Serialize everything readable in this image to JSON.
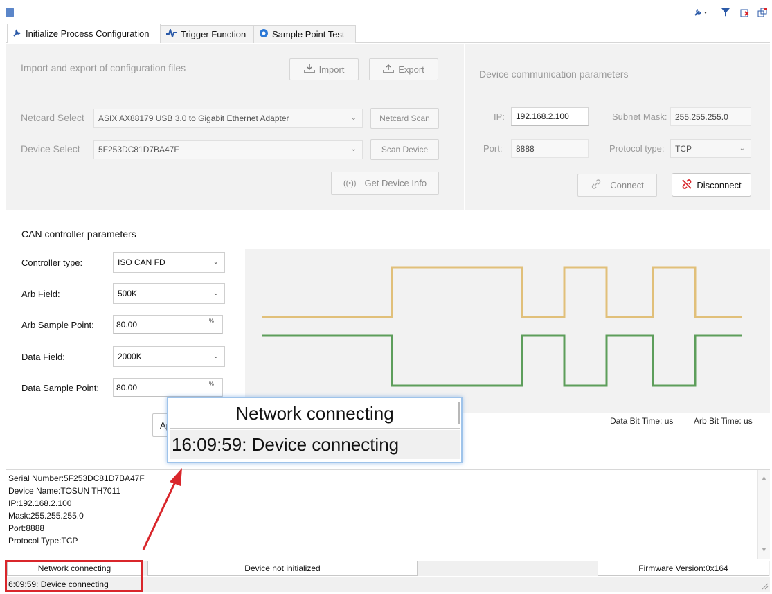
{
  "toolbar": {
    "icons": [
      "app-icon",
      "wrench-dropdown-icon",
      "filter-icon",
      "close-red-icon",
      "restore-icon"
    ]
  },
  "tabs": [
    {
      "label": "Initialize Process Configuration",
      "icon": "wrench-icon",
      "active": true
    },
    {
      "label": "Trigger Function",
      "icon": "waveform-icon",
      "active": false
    },
    {
      "label": "Sample Point Test",
      "icon": "target-icon",
      "active": false
    }
  ],
  "config": {
    "heading": "Import and export of configuration files",
    "import_label": "Import",
    "export_label": "Export",
    "netcard_label": "Netcard Select",
    "netcard_value": "ASIX AX88179 USB 3.0 to Gigabit Ethernet Adapter",
    "netcard_scan_label": "Netcard Scan",
    "device_label": "Device Select",
    "device_value": "5F253DC81D7BA47F",
    "scan_device_label": "Scan Device",
    "get_info_label": "Get Device Info"
  },
  "comm": {
    "heading": "Device communication parameters",
    "ip_label": "IP:",
    "ip_value": "192.168.2.100",
    "mask_label": "Subnet Mask:",
    "mask_value": "255.255.255.0",
    "port_label": "Port:",
    "port_value": "8888",
    "protocol_label": "Protocol type:",
    "protocol_value": "TCP",
    "connect_label": "Connect",
    "disconnect_label": "Disconnect"
  },
  "can": {
    "heading": "CAN controller parameters",
    "controller_type_label": "Controller type:",
    "controller_type_value": "ISO CAN FD",
    "arb_field_label": "Arb Field:",
    "arb_field_value": "500K",
    "arb_sample_label": "Arb Sample Point:",
    "arb_sample_value": "80.00",
    "data_field_label": "Data Field:",
    "data_field_value": "2000K",
    "data_sample_label": "Data Sample Point:",
    "data_sample_value": "80.00",
    "percent_unit": "%",
    "apply_partial": "Ap",
    "data_bit_time": "Data Bit Time: us",
    "arb_bit_time": "Arb Bit Time: us",
    "wave_colors": {
      "arb": "#e1c07a",
      "data": "#5d9e5b"
    }
  },
  "log": {
    "lines": [
      "Serial Number:5F253DC81D7BA47F",
      "Device Name:TOSUN TH7011",
      "IP:192.168.2.100",
      "Mask:255.255.255.0",
      "Port:8888",
      "Protocol Type:TCP"
    ]
  },
  "status": {
    "network": "Network connecting",
    "device": "Device not initialized",
    "firmware": "Firmware Version:0x164",
    "message": "6:09:59: Device connecting"
  },
  "popup": {
    "top_text": "Network connecting",
    "bottom_text": "16:09:59: Device connecting"
  },
  "colors": {
    "annotation_red": "#d9262b",
    "panel_gray": "#f2f2f2"
  }
}
